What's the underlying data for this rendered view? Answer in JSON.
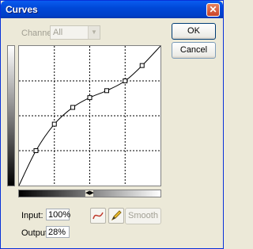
{
  "window": {
    "title": "Curves",
    "close_glyph": "✕"
  },
  "channel": {
    "label": "Channel:",
    "value": "All"
  },
  "buttons": {
    "ok": "OK",
    "cancel": "Cancel",
    "smooth": "Smooth"
  },
  "input": {
    "label": "Input:",
    "value": "100%"
  },
  "output": {
    "label": "Output:",
    "value": "28%"
  },
  "curve": {
    "points": [
      [
        0,
        0
      ],
      [
        0.12,
        0.25
      ],
      [
        0.25,
        0.44
      ],
      [
        0.38,
        0.56
      ],
      [
        0.5,
        0.63
      ],
      [
        0.62,
        0.68
      ],
      [
        0.75,
        0.75
      ],
      [
        0.87,
        0.86
      ],
      [
        1,
        1
      ]
    ],
    "grid_divisions": 4
  },
  "icons": {
    "curve_tool": "curve-icon",
    "pencil_tool": "pencil-icon",
    "slider": "slider-handle-icon"
  },
  "colors": {
    "titlebar": "#0054e3",
    "close": "#d7542f",
    "curve": "#000000"
  }
}
